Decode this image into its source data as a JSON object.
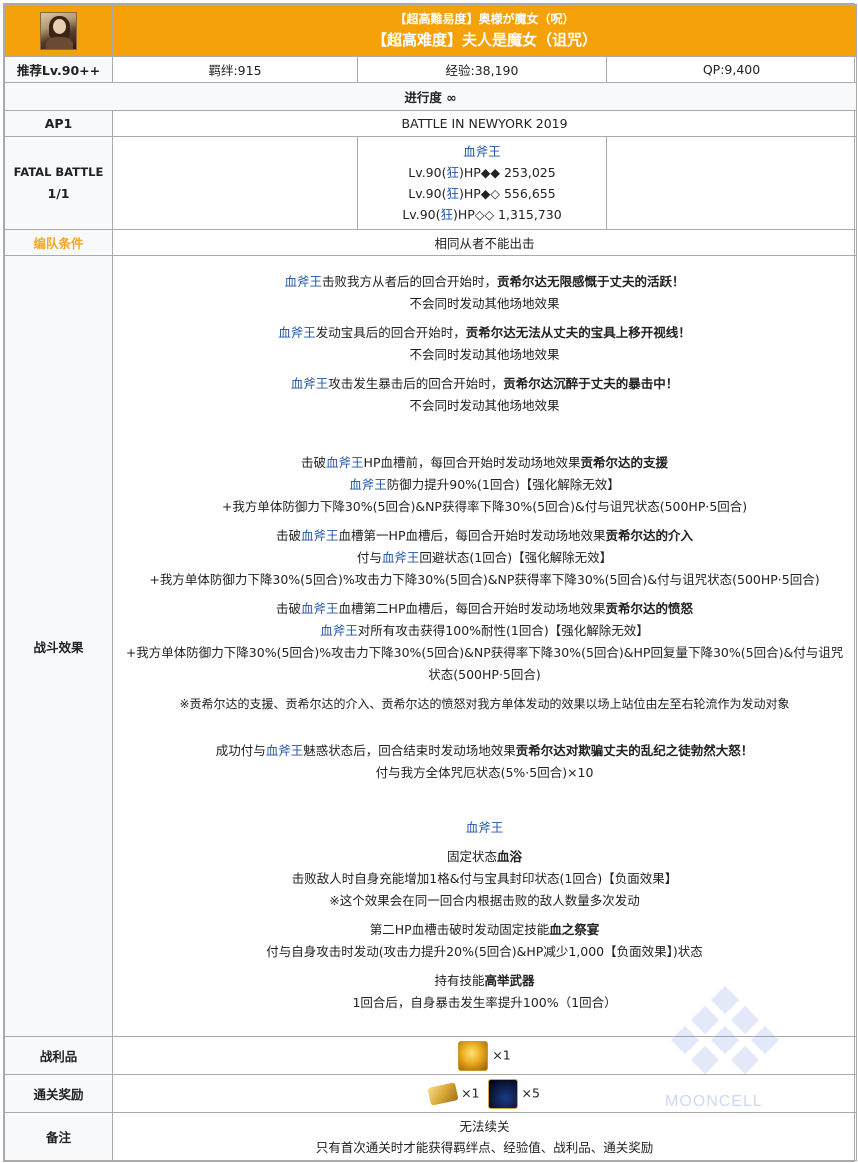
{
  "title": {
    "jp": "【超高難易度】奥様が魔女（呪）",
    "cn": "【超高难度】夫人是魔女（诅咒）"
  },
  "summary": {
    "level_label": "推荐Lv.90++",
    "bond": "羁绊:915",
    "exp": "经验:38,190",
    "qp": "QP:9,400"
  },
  "progress": "进行度 ∞",
  "ap": {
    "label": "AP1",
    "stage": "BATTLE IN NEWYORK 2019"
  },
  "fatal": {
    "label1": "FATAL BATTLE",
    "label2": "1/1",
    "enemy_name": "血斧王",
    "rows": [
      {
        "pre": "Lv.90(",
        "cls": "狂",
        "post": ")HP◆◆ 253,025"
      },
      {
        "pre": "Lv.90(",
        "cls": "狂",
        "post": ")HP◆◇ 556,655"
      },
      {
        "pre": "Lv.90(",
        "cls": "狂",
        "post": ")HP◇◇ 1,315,730"
      }
    ]
  },
  "formation": {
    "label": "编队条件",
    "value": "相同从者不能出击"
  },
  "battle": {
    "label": "战斗效果",
    "e1a": "血斧王",
    "e1b": "击败我方从者后的回合开始时，",
    "e1c": "贡希尔达无限感慨于丈夫的活跃！",
    "e1d": "不会同时发动其他场地效果",
    "e2a": "血斧王",
    "e2b": "发动宝具后的回合开始时，",
    "e2c": "贡希尔达无法从丈夫的宝具上移开视线！",
    "e2d": "不会同时发动其他场地效果",
    "e3a": "血斧王",
    "e3b": "攻击发生暴击后的回合开始时，",
    "e3c": "贡希尔达沉醉于丈夫的暴击中！",
    "e3d": "不会同时发动其他场地效果",
    "s1a": "击破",
    "s1b": "血斧王",
    "s1c": "HP血槽前，每回合开始时发动场地效果",
    "s1d": "贡希尔达的支援",
    "s1e": "血斧王",
    "s1f": "防御力提升90%(1回合)【强化解除无效】",
    "s1g": "+我方单体防御力下降30%(5回合)&NP获得率下降30%(5回合)&付与诅咒状态(500HP·5回合)",
    "s2a": "击破",
    "s2b": "血斧王",
    "s2c": "血槽第一HP血槽后，每回合开始时发动场地效果",
    "s2d": "贡希尔达的介入",
    "s2e": "付与",
    "s2f": "血斧王",
    "s2g": "回避状态(1回合)【强化解除无效】",
    "s2h": "+我方单体防御力下降30%(5回合)%攻击力下降30%(5回合)&NP获得率下降30%(5回合)&付与诅咒状态(500HP·5回合)",
    "s3a": "击破",
    "s3b": "血斧王",
    "s3c": "血槽第二HP血槽后，每回合开始时发动场地效果",
    "s3d": "贡希尔达的愤怒",
    "s3e": "血斧王",
    "s3f": "对所有攻击获得100%耐性(1回合)【强化解除无效】",
    "s3g": "+我方单体防御力下降30%(5回合)%攻击力下降30%(5回合)&NP获得率下降30%(5回合)&HP回复量下降30%(5回合)&付与诅咒状态(500HP·5回合)",
    "note": "※贡希尔达的支援、贡希尔达的介入、贡希尔达的愤怒对我方单体发动的效果以场上站位由左至右轮流作为发动对象",
    "c1a": "成功付与",
    "c1b": "血斧王",
    "c1c": "魅惑状态后，回合结束时发动场地效果",
    "c1d": "贡希尔达对欺骗丈夫的乱纪之徒勃然大怒！",
    "c1e": "付与我方全体咒厄状态(5%·5回合)×10",
    "boss": "血斧王",
    "p1a": "固定状态",
    "p1b": "血浴",
    "p1c": "击败敌人时自身充能增加1格&付与宝具封印状态(1回合)【负面效果】",
    "p1d": "※这个效果会在同一回合内根据击败的敌人数量多次发动",
    "p2a": "第二HP血槽击破时发动固定技能",
    "p2b": "血之祭宴",
    "p2c": "付与自身攻击时发动(攻击力提升20%(5回合)&HP减少1,000【负面效果】)状态",
    "p3a": "持有技能",
    "p3b": "高举武器",
    "p3c": "1回合后，自身暴击发生率提升100%（1回合）"
  },
  "drops": {
    "label": "战利品",
    "count": "×1"
  },
  "rewards": {
    "label": "通关奖励",
    "count1": "×1",
    "count2": "×5"
  },
  "remarks": {
    "label": "备注",
    "line1": "无法续关",
    "line2": "只有首次通关时才能获得羁绊点、经验值、战利品、通关奖励"
  },
  "watermark": "MOONCELL"
}
